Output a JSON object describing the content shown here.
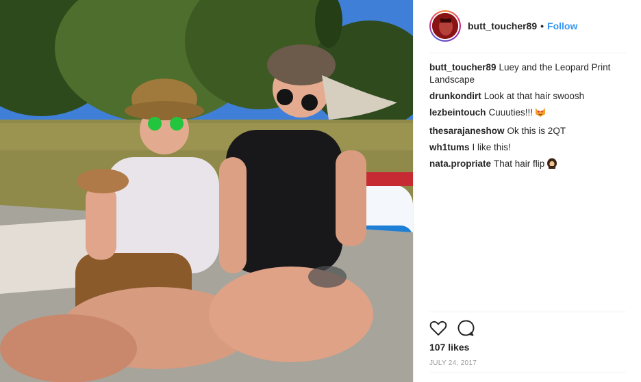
{
  "post": {
    "username": "butt_toucher89",
    "separator": "•",
    "follow_label": "Follow"
  },
  "comments": [
    {
      "user": "butt_toucher89",
      "text": "Luey and the Leopard Print Landscape"
    },
    {
      "user": "drunkondirt",
      "text": "Look at that hair swoosh"
    },
    {
      "user": "lezbeintouch",
      "text": "Cuuuties!!!",
      "emoji": "heart-eyes-cat-emoji"
    },
    {
      "user": "thesarajaneshow",
      "text": "Ok this is 2QT"
    },
    {
      "user": "wh1tums",
      "text": "I like this!"
    },
    {
      "user": "nata.propriate",
      "text": "That hair flip",
      "emoji": "woman-hair-emoji"
    }
  ],
  "actions": {
    "like_icon": "heart-outline-icon",
    "comment_icon": "speech-bubble-icon"
  },
  "likes": "107 likes",
  "date": "JULY 24, 2017",
  "colors": {
    "link": "#3897f0",
    "text": "#262626",
    "muted": "#999999",
    "border": "#efefef"
  }
}
